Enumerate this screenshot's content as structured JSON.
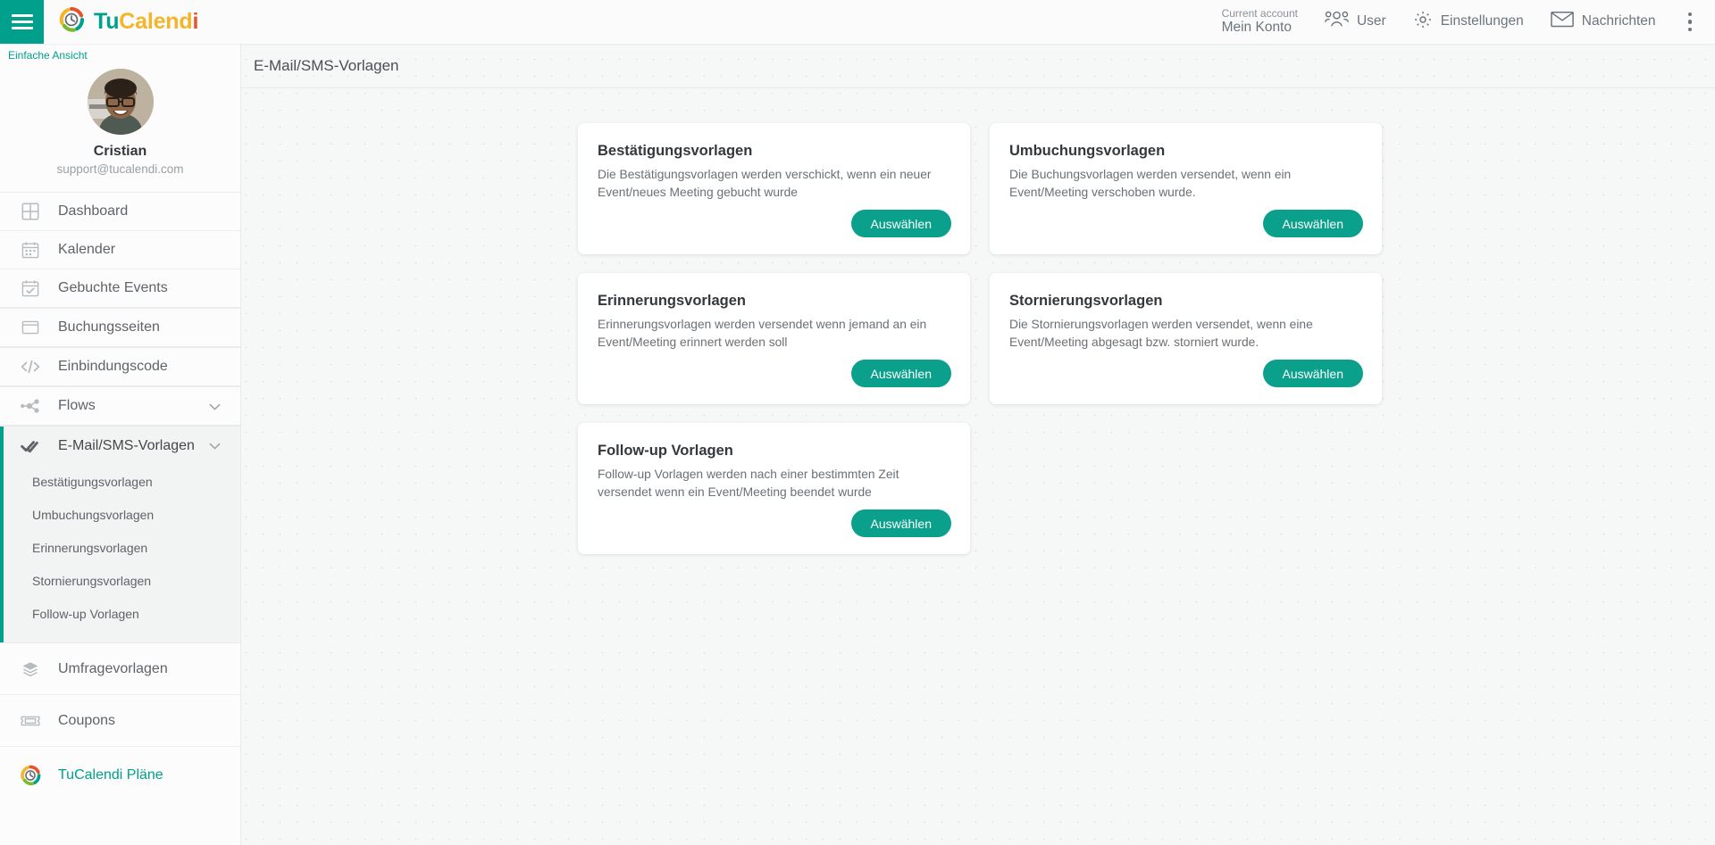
{
  "topbar": {
    "menu_icon": "hamburger-icon",
    "brand": {
      "part1": "Tu",
      "part2": "Calend",
      "part3": "i"
    },
    "account": {
      "label": "Current account",
      "name": "Mein Konto"
    },
    "nav": [
      {
        "icon": "people-icon",
        "label": "User"
      },
      {
        "icon": "gear-icon",
        "label": "Einstellungen"
      },
      {
        "icon": "envelope-icon",
        "label": "Nachrichten"
      }
    ],
    "overflow_icon": "kebab-menu-icon"
  },
  "sidebar": {
    "simple_view": "Einfache Ansicht",
    "profile": {
      "name": "Cristian",
      "email": "support@tucalendi.com",
      "avatar": "user-avatar"
    },
    "items": [
      {
        "label": "Dashboard",
        "icon": "grid-icon"
      },
      {
        "label": "Kalender",
        "icon": "calendar-icon"
      },
      {
        "label": "Gebuchte Events",
        "icon": "calendar-check-icon"
      },
      {
        "label": "Buchungsseiten",
        "icon": "browser-window-icon"
      },
      {
        "label": "Einbindungscode",
        "icon": "code-icon"
      },
      {
        "label": "Flows",
        "icon": "flow-nodes-icon",
        "chevron": "⌄"
      },
      {
        "label": "E-Mail/SMS-Vorlagen",
        "icon": "double-check-icon",
        "chevron": "⌄",
        "active": true
      }
    ],
    "submenu": [
      "Bestätigungsvorlagen",
      "Umbuchungsvorlagen",
      "Erinnerungsvorlagen",
      "Stornierungsvorlagen",
      "Follow-up Vorlagen"
    ],
    "items_bottom": [
      {
        "label": "Umfragevorlagen",
        "icon": "layers-icon"
      },
      {
        "label": "Coupons",
        "icon": "ticket-icon"
      },
      {
        "label": "TuCalendi Pläne",
        "icon": "tucalendi-logo-icon"
      }
    ]
  },
  "main": {
    "page_title": "E-Mail/SMS-Vorlagen",
    "cards": [
      {
        "title": "Bestätigungsvorlagen",
        "description": "Die Bestätigungsvorlagen werden verschickt, wenn ein neuer Event/neues Meeting gebucht wurde",
        "button": "Auswählen"
      },
      {
        "title": "Umbuchungsvorlagen",
        "description": "Die Buchungsvorlagen werden versendet, wenn ein Event/Meeting verschoben wurde.",
        "button": "Auswählen"
      },
      {
        "title": "Erinnerungsvorlagen",
        "description": "Erinnerungsvorlagen werden versendet wenn jemand an ein Event/Meeting erinnert werden soll",
        "button": "Auswählen"
      },
      {
        "title": "Stornierungsvorlagen",
        "description": "Die Stornierungsvorlagen werden versendet, wenn eine Event/Meeting abgesagt bzw. storniert wurde.",
        "button": "Auswählen"
      },
      {
        "title": "Follow-up Vorlagen",
        "description": "Follow-up Vorlagen werden nach einer bestimmten Zeit versendet wenn ein Event/Meeting beendet wurde",
        "button": "Auswählen"
      }
    ]
  },
  "colors": {
    "accent": "#00a08c",
    "button": "#0ba08c",
    "brand_yellow": "#f5b52a",
    "brand_orange": "#e8542a",
    "text": "#5f6368"
  }
}
